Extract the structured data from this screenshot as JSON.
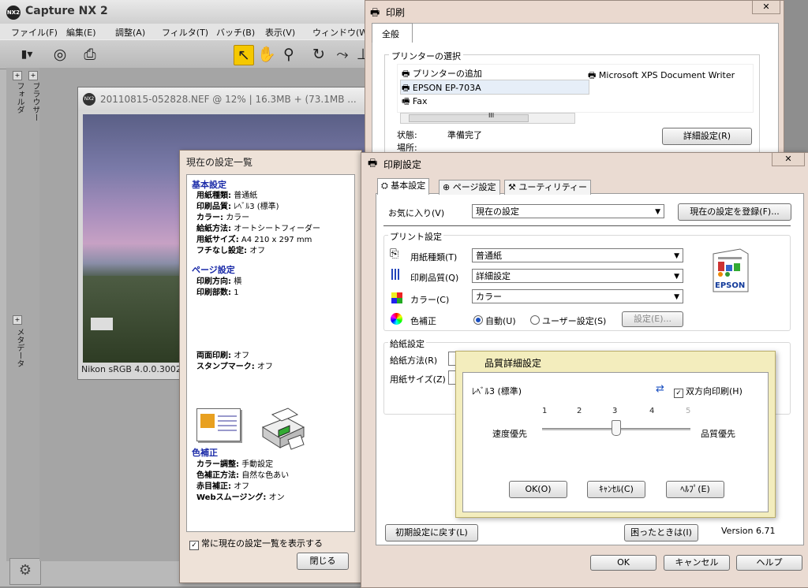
{
  "app": {
    "title": "Capture NX 2",
    "logo_text": "NX2",
    "menu": [
      "ファイル(F)",
      "編集(E)",
      "調整(A)",
      "フィルタ(T)",
      "バッチ(B)",
      "表示(V)",
      "ウィンドウ(W)"
    ],
    "side_labels": {
      "browser": "ブラウザー",
      "folder": "フォルダ",
      "metadata": "メタデータ"
    },
    "image_window": {
      "title": "20110815-052828.NEF  @ 12%  |  16.3MB  +  (73.1MB  ...",
      "status": "Nikon sRGB 4.0.0.3002"
    }
  },
  "current_settings": {
    "title": "現在の設定一覧",
    "basic": {
      "header": "基本設定",
      "rows": [
        {
          "label": "用紙種類:",
          "value": "普通紙"
        },
        {
          "label": "印刷品質:",
          "value": "ﾚﾍﾞﾙ3 (標準)"
        },
        {
          "label": "カラー:",
          "value": "カラー"
        },
        {
          "label": "給紙方法:",
          "value": "オートシートフィーダー"
        },
        {
          "label": "用紙サイズ:",
          "value": "A4 210 x 297 mm"
        },
        {
          "label": "フチなし設定:",
          "value": "オフ"
        }
      ]
    },
    "page": {
      "header": "ページ設定",
      "rows": [
        {
          "label": "印刷方向:",
          "value": "横"
        },
        {
          "label": "印刷部数:",
          "value": "1"
        }
      ]
    },
    "duplex": [
      {
        "label": "両面印刷:",
        "value": "オフ"
      },
      {
        "label": "スタンプマーク:",
        "value": "オフ"
      }
    ],
    "color": {
      "header": "色補正",
      "rows": [
        {
          "label": "カラー調整:",
          "value": "手動設定"
        },
        {
          "label": "色補正方法:",
          "value": "自然な色あい"
        },
        {
          "label": "赤目補正:",
          "value": "オフ"
        },
        {
          "label": "Webスムージング:",
          "value": "オン"
        }
      ]
    },
    "always_show_label": "常に現在の設定一覧を表示する",
    "close_button": "閉じる"
  },
  "print_dialog": {
    "title": "印刷",
    "tab": "全般",
    "group_label": "プリンターの選択",
    "printers": [
      "プリンターの追加",
      "Microsoft XPS Document Writer",
      "EPSON EP-703A",
      "Fax"
    ],
    "scroll_label": "III",
    "status_label": "状態:",
    "status_value": "準備完了",
    "location_label": "場所:",
    "advanced_button": "詳細設定(R)"
  },
  "print_settings": {
    "title": "印刷設定",
    "tabs": [
      "基本設定",
      "ページ設定",
      "ユーティリティー"
    ],
    "favorites_label": "お気に入り(V)",
    "favorites_value": "現在の設定",
    "register_button": "現在の設定を登録(F)...",
    "print_group": "プリント設定",
    "paper_type_label": "用紙種類(T)",
    "paper_type_value": "普通紙",
    "quality_label": "印刷品質(Q)",
    "quality_value": "詳細設定",
    "color_label": "カラー(C)",
    "color_value": "カラー",
    "correction_label": "色補正",
    "correction_auto": "自動(U)",
    "correction_user": "ユーザー設定(S)",
    "correction_button": "設定(E)...",
    "brand": "EPSON",
    "feed_group": "給紙設定",
    "feed_label": "給紙方法(R)",
    "size_label": "用紙サイズ(Z)",
    "reset_button": "初期設定に戻す(L)",
    "help_button": "困ったときは(I)",
    "version": "Version 6.71",
    "ok": "OK",
    "cancel": "キャンセル",
    "help": "ヘルプ"
  },
  "quality_dialog": {
    "title": "品質詳細設定",
    "level": "ﾚﾍﾞﾙ3 (標準)",
    "bidirectional_label": "双方向印刷(H)",
    "ticks": [
      "1",
      "2",
      "3",
      "4",
      "5"
    ],
    "slider_value": 3,
    "left_label": "速度優先",
    "right_label": "品質優先",
    "ok": "OK(O)",
    "cancel": "ｷｬﾝｾﾙ(C)",
    "help": "ﾍﾙﾌﾟ(E)"
  }
}
